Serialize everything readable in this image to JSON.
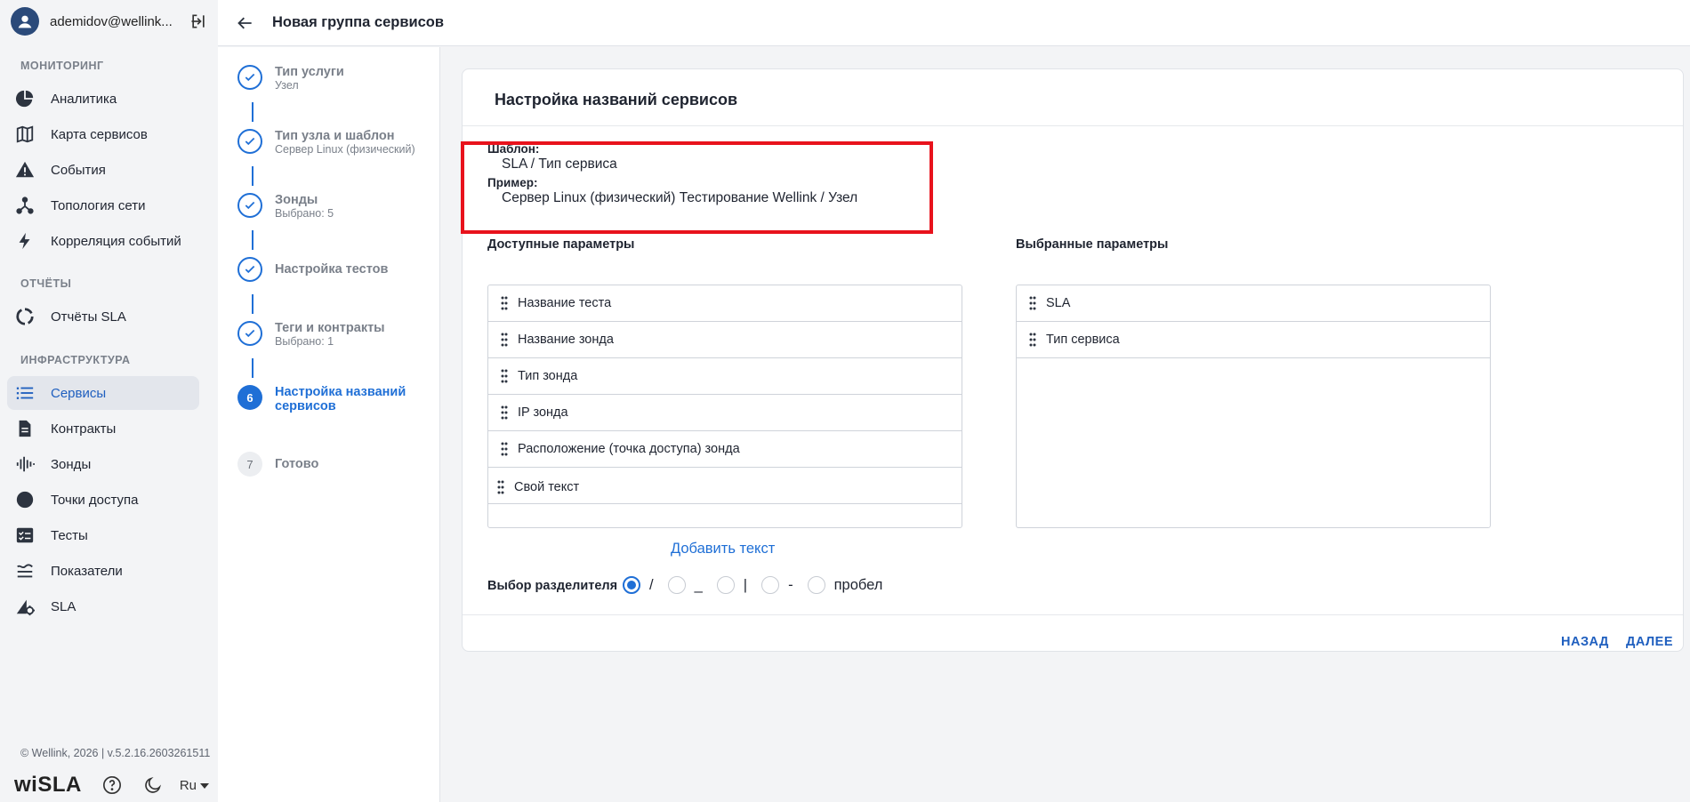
{
  "sidebar": {
    "user_name": "ademidov@wellink...",
    "sections": {
      "monitoring": "МОНИТОРИНГ",
      "reports": "ОТЧЁТЫ",
      "infrastructure": "ИНФРАСТРУКТУРА"
    },
    "items": [
      {
        "label": "Аналитика",
        "icon": "pie-chart-icon"
      },
      {
        "label": "Карта сервисов",
        "icon": "map-icon"
      },
      {
        "label": "События",
        "icon": "warning-icon"
      },
      {
        "label": "Топология сети",
        "icon": "topology-icon"
      },
      {
        "label": "Корреляция событий",
        "icon": "lightning-icon"
      },
      {
        "label": "Отчёты SLA",
        "icon": "report-ring-icon"
      },
      {
        "label": "Сервисы",
        "icon": "list-icon",
        "active": true
      },
      {
        "label": "Контракты",
        "icon": "document-icon"
      },
      {
        "label": "Зонды",
        "icon": "probe-icon"
      },
      {
        "label": "Точки доступа",
        "icon": "circle-icon"
      },
      {
        "label": "Тесты",
        "icon": "checklist-icon"
      },
      {
        "label": "Показатели",
        "icon": "metrics-icon"
      },
      {
        "label": "SLA",
        "icon": "sla-icon"
      }
    ],
    "copyright": "© Wellink, 2026 | v.5.2.16.2603261511",
    "brand": "wiSLA",
    "language": "Ru"
  },
  "header": {
    "title": "Новая группа сервисов"
  },
  "stepper": {
    "steps": [
      {
        "number": "1",
        "title": "Тип услуги",
        "subtitle": "Узел",
        "state": "done"
      },
      {
        "number": "2",
        "title": "Тип узла и шаблон",
        "subtitle": "Сервер Linux (физический)",
        "state": "done"
      },
      {
        "number": "3",
        "title": "Зонды",
        "subtitle": "Выбрано: 5",
        "state": "done"
      },
      {
        "number": "4",
        "title": "Настройка тестов",
        "subtitle": "",
        "state": "done"
      },
      {
        "number": "5",
        "title": "Теги и контракты",
        "subtitle": "Выбрано: 1",
        "state": "done"
      },
      {
        "number": "6",
        "title": "Настройка названий сервисов",
        "subtitle": "",
        "state": "current"
      },
      {
        "number": "7",
        "title": "Готово",
        "subtitle": "",
        "state": "future"
      }
    ]
  },
  "card": {
    "title": "Настройка названий сервисов",
    "template_label": "Шаблон:",
    "template_value": "SLA / Тип сервиса",
    "example_label": "Пример:",
    "example_value": "Сервер Linux (физический) Тестирование Wellink / Узел",
    "available_title": "Доступные параметры",
    "selected_title": "Выбранные параметры",
    "available_params": [
      "Название теста",
      "Название зонда",
      "Тип зонда",
      "IP зонда",
      "Расположение (точка доступа) зонда",
      "Свой текст"
    ],
    "selected_params": [
      "SLA",
      "Тип сервиса"
    ],
    "add_text": "Добавить текст",
    "separator_label": "Выбор разделителя",
    "separators": [
      {
        "label": "/",
        "checked": true
      },
      {
        "label": "_",
        "checked": false
      },
      {
        "label": "|",
        "checked": false
      },
      {
        "label": "-",
        "checked": false
      },
      {
        "label": "пробел",
        "checked": false
      }
    ],
    "back_button": "НАЗАД",
    "next_button": "ДАЛЕЕ"
  },
  "colors": {
    "accent": "#1f6fd6",
    "highlight_frame": "#e8121c",
    "sidebar_bg": "#f3f4f6"
  }
}
